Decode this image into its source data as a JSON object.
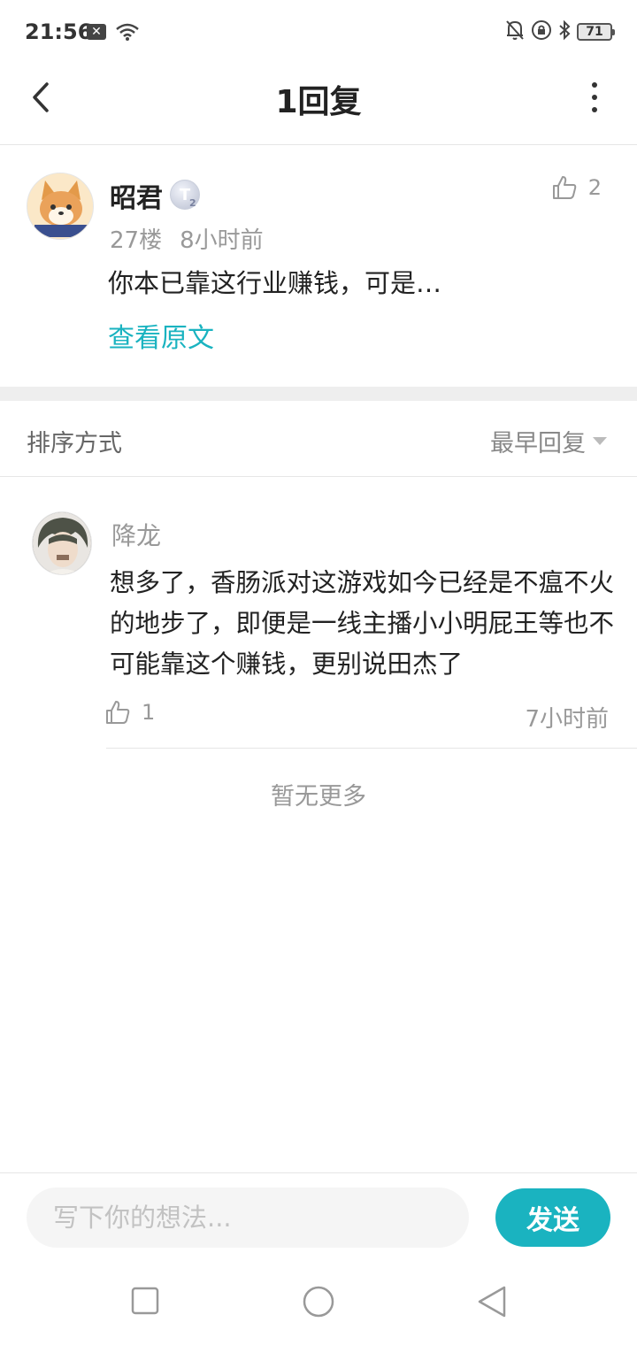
{
  "status_bar": {
    "time": "21:56",
    "notification_icon": "x-notification-icon",
    "battery": "71"
  },
  "header": {
    "title": "1回复",
    "back_icon": "chevron-left-icon",
    "more_icon": "more-vertical-icon"
  },
  "original_comment": {
    "author": "昭君",
    "level_badge": "T",
    "level_sub": "2",
    "floor": "27楼",
    "time": "8小时前",
    "text": "你本已靠这行业赚钱，可是…",
    "view_original_label": "查看原文",
    "like_count": "2"
  },
  "sort": {
    "label": "排序方式",
    "selected": "最早回复"
  },
  "replies": [
    {
      "author": "降龙",
      "text": "想多了，香肠派对这游戏如今已经是不瘟不火的地步了，即便是一线主播小小明屁王等也不可能靠这个赚钱，更别说田杰了",
      "like_count": "1",
      "time": "7小时前"
    }
  ],
  "no_more_label": "暂无更多",
  "input": {
    "placeholder": "写下你的想法...",
    "value": ""
  },
  "send_label": "发送",
  "colors": {
    "accent": "#1ab3c0",
    "muted_text": "#999999",
    "divider": "#e6e6e6"
  },
  "system_nav": {
    "recent_icon": "square-icon",
    "home_icon": "circle-icon",
    "back_icon": "triangle-back-icon"
  }
}
